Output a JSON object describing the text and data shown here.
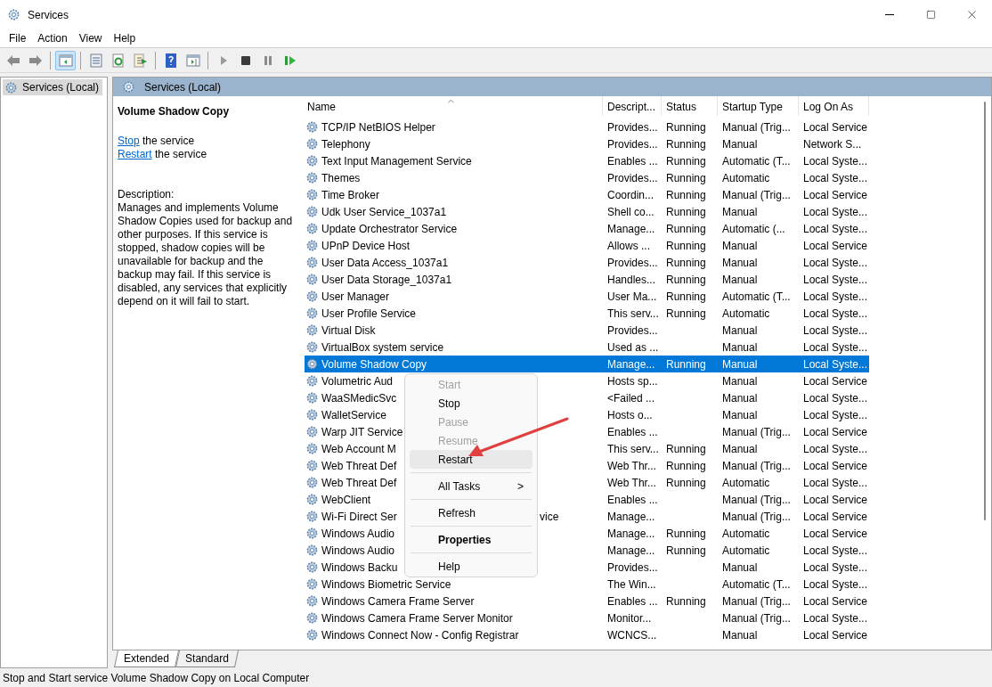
{
  "window": {
    "title": "Services"
  },
  "menu_bar": [
    "File",
    "Action",
    "View",
    "Help"
  ],
  "toolbar": [
    {
      "selected": false
    },
    {
      "selected": false
    },
    {
      "selected": true
    },
    {
      "selected": false
    },
    {
      "selected": false
    },
    {
      "selected": false
    },
    {
      "selected": false
    },
    {
      "selected": false
    },
    {
      "selected": false
    },
    {
      "selected": false
    },
    {
      "selected": false
    },
    {
      "selected": false
    }
  ],
  "tree": {
    "items": [
      {
        "label": "Services (Local)",
        "selected": true
      }
    ]
  },
  "pane_header": "Services (Local)",
  "details": {
    "title": "Volume Shadow Copy",
    "actions": [
      {
        "link": "Stop",
        "text": "the service"
      },
      {
        "link": "Restart",
        "text": "the service"
      }
    ],
    "description_label": "Description:",
    "description": "Manages and implements Volume Shadow Copies used for backup and other purposes. If this service is stopped, shadow copies will be unavailable for backup and the backup may fail. If this service is disabled, any services that explicitly depend on it will fail to start."
  },
  "table": {
    "columns": [
      "Name",
      "Descript...",
      "Status",
      "Startup Type",
      "Log On As"
    ],
    "rows": [
      {
        "name": "TCP/IP NetBIOS Helper",
        "description": "Provides...",
        "status": "Running",
        "startup": "Manual (Trig...",
        "logon": "Local Service",
        "selected": false
      },
      {
        "name": "Telephony",
        "description": "Provides...",
        "status": "Running",
        "startup": "Manual",
        "logon": "Network S...",
        "selected": false
      },
      {
        "name": "Text Input Management Service",
        "description": "Enables ...",
        "status": "Running",
        "startup": "Automatic (T...",
        "logon": "Local Syste...",
        "selected": false
      },
      {
        "name": "Themes",
        "description": "Provides...",
        "status": "Running",
        "startup": "Automatic",
        "logon": "Local Syste...",
        "selected": false
      },
      {
        "name": "Time Broker",
        "description": "Coordin...",
        "status": "Running",
        "startup": "Manual (Trig...",
        "logon": "Local Service",
        "selected": false
      },
      {
        "name": "Udk User Service_1037a1",
        "description": "Shell co...",
        "status": "Running",
        "startup": "Manual",
        "logon": "Local Syste...",
        "selected": false
      },
      {
        "name": "Update Orchestrator Service",
        "description": "Manage...",
        "status": "Running",
        "startup": "Automatic (...",
        "logon": "Local Syste...",
        "selected": false
      },
      {
        "name": "UPnP Device Host",
        "description": "Allows ...",
        "status": "Running",
        "startup": "Manual",
        "logon": "Local Service",
        "selected": false
      },
      {
        "name": "User Data Access_1037a1",
        "description": "Provides...",
        "status": "Running",
        "startup": "Manual",
        "logon": "Local Syste...",
        "selected": false
      },
      {
        "name": "User Data Storage_1037a1",
        "description": "Handles...",
        "status": "Running",
        "startup": "Manual",
        "logon": "Local Syste...",
        "selected": false
      },
      {
        "name": "User Manager",
        "description": "User Ma...",
        "status": "Running",
        "startup": "Automatic (T...",
        "logon": "Local Syste...",
        "selected": false
      },
      {
        "name": "User Profile Service",
        "description": "This serv...",
        "status": "Running",
        "startup": "Automatic",
        "logon": "Local Syste...",
        "selected": false
      },
      {
        "name": "Virtual Disk",
        "description": "Provides...",
        "startup": "Manual",
        "logon": "Local Syste...",
        "selected": false
      },
      {
        "name": "VirtualBox system service",
        "description": "Used as ...",
        "startup": "Manual",
        "logon": "Local Syste...",
        "selected": false
      },
      {
        "name": "Volume Shadow Copy",
        "description": "Manage...",
        "status": "Running",
        "startup": "Manual",
        "logon": "Local Syste...",
        "selected": true
      },
      {
        "name": "Volumetric Aud",
        "description": "Hosts sp...",
        "startup": "Manual",
        "logon": "Local Service",
        "selected": false
      },
      {
        "name": "WaaSMedicSvc",
        "description": "<Failed ...",
        "startup": "Manual",
        "logon": "Local Syste...",
        "selected": false
      },
      {
        "name": "WalletService",
        "description": "Hosts o...",
        "startup": "Manual",
        "logon": "Local Syste...",
        "selected": false
      },
      {
        "name": "Warp JIT Service",
        "description": "Enables ...",
        "startup": "Manual (Trig...",
        "logon": "Local Service",
        "selected": false
      },
      {
        "name": "Web Account M",
        "description": "This serv...",
        "status": "Running",
        "startup": "Manual",
        "logon": "Local Syste...",
        "selected": false
      },
      {
        "name": "Web Threat Def",
        "description": "Web Thr...",
        "status": "Running",
        "startup": "Manual (Trig...",
        "logon": "Local Service",
        "selected": false
      },
      {
        "name": "Web Threat Def",
        "description": "Web Thr...",
        "status": "Running",
        "startup": "Automatic",
        "logon": "Local Syste...",
        "selected": false
      },
      {
        "name": "WebClient",
        "description": "Enables ...",
        "startup": "Manual (Trig...",
        "logon": "Local Service",
        "selected": false
      },
      {
        "name": "Wi-Fi Direct Ser",
        "name_tail": "vice",
        "description": "Manage...",
        "startup": "Manual (Trig...",
        "logon": "Local Service",
        "selected": false
      },
      {
        "name": "Windows Audio",
        "description": "Manage...",
        "status": "Running",
        "startup": "Automatic",
        "logon": "Local Service",
        "selected": false
      },
      {
        "name": "Windows Audio",
        "description": "Manage...",
        "status": "Running",
        "startup": "Automatic",
        "logon": "Local Syste...",
        "selected": false
      },
      {
        "name": "Windows Backu",
        "description": "Provides...",
        "startup": "Manual",
        "logon": "Local Syste...",
        "selected": false
      },
      {
        "name": "Windows Biometric Service",
        "description": "The Win...",
        "startup": "Automatic (T...",
        "logon": "Local Syste...",
        "selected": false
      },
      {
        "name": "Windows Camera Frame Server",
        "description": "Enables ...",
        "status": "Running",
        "startup": "Manual (Trig...",
        "logon": "Local Service",
        "selected": false
      },
      {
        "name": "Windows Camera Frame Server Monitor",
        "description": "Monitor...",
        "startup": "Manual (Trig...",
        "logon": "Local Syste...",
        "selected": false
      },
      {
        "name": "Windows Connect Now - Config Registrar",
        "description": "WCNCS...",
        "startup": "Manual",
        "logon": "Local Service",
        "selected": false
      }
    ]
  },
  "context_menu": [
    {
      "kind": "item",
      "label": "Start",
      "disabled": true,
      "selected": false
    },
    {
      "kind": "item",
      "label": "Stop",
      "disabled": false,
      "selected": false
    },
    {
      "kind": "item",
      "label": "Pause",
      "disabled": true,
      "selected": false
    },
    {
      "kind": "item",
      "label": "Resume",
      "disabled": true,
      "selected": false
    },
    {
      "kind": "item",
      "label": "Restart",
      "disabled": false,
      "selected": true
    },
    {
      "kind": "separator"
    },
    {
      "kind": "submenu",
      "label": "All Tasks",
      "arrow": ">",
      "disabled": false,
      "selected": false
    },
    {
      "kind": "separator"
    },
    {
      "kind": "item",
      "label": "Refresh",
      "disabled": false,
      "selected": false
    },
    {
      "kind": "separator"
    },
    {
      "kind": "item",
      "label": "Properties",
      "disabled": false,
      "selected": false,
      "bold": true
    },
    {
      "kind": "separator"
    },
    {
      "kind": "item",
      "label": "Help",
      "disabled": false,
      "selected": false
    }
  ],
  "view_tabs": [
    {
      "label": "Extended",
      "selected": true
    },
    {
      "label": "Standard",
      "selected": false
    }
  ],
  "status_bar": "Stop and Start service Volume Shadow Copy on Local Computer"
}
